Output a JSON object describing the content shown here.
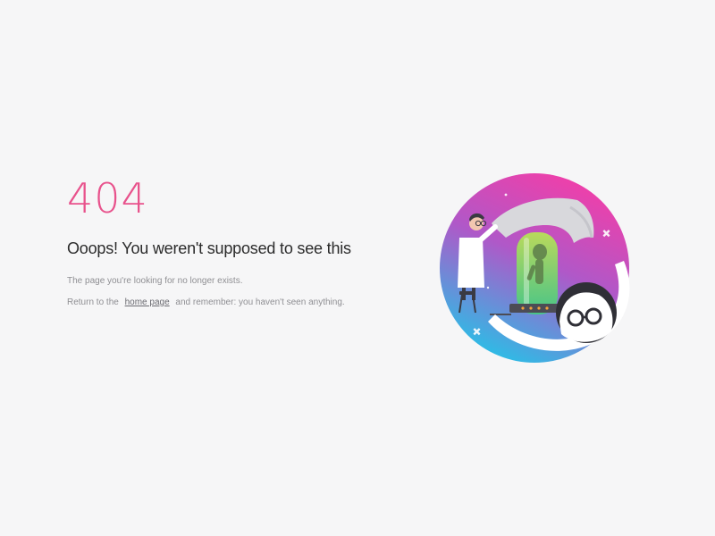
{
  "error": {
    "code": "404",
    "headline": "Ooops! You weren't supposed to see this",
    "message": "The page you're looking for no longer exists.",
    "return_prefix": "Return to the",
    "return_link": "home page",
    "return_suffix": "and remember: you haven't seen anything."
  },
  "colors": {
    "accent": "#e8528c",
    "circle_top": "#f23ea8",
    "circle_bottom": "#23c4e8",
    "background": "#f6f6f7"
  },
  "illustration": {
    "description_icon": "scientist-lab-icon"
  }
}
